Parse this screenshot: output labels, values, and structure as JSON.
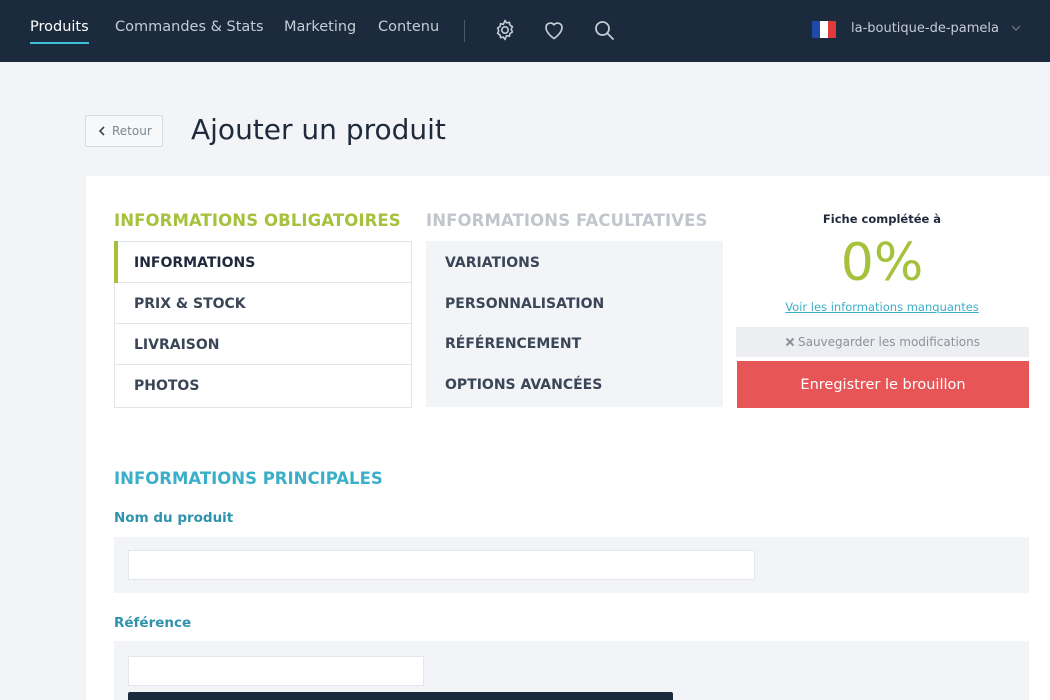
{
  "nav": {
    "items": [
      {
        "label": "Produits"
      },
      {
        "label": "Commandes & Stats"
      },
      {
        "label": "Marketing"
      },
      {
        "label": "Contenu"
      }
    ],
    "shop_name": "la-boutique-de-pamela",
    "flag_colors": [
      "#1f4aa8",
      "#ffffff",
      "#e03b3b"
    ],
    "icons": [
      "gear-icon",
      "heart-icon",
      "search-icon"
    ]
  },
  "header": {
    "back_label": "Retour",
    "title": "Ajouter un produit"
  },
  "required": {
    "title": "INFORMATIONS OBLIGATOIRES",
    "items": [
      {
        "label": "INFORMATIONS"
      },
      {
        "label": "PRIX & STOCK"
      },
      {
        "label": "LIVRAISON"
      },
      {
        "label": "PHOTOS"
      }
    ]
  },
  "optional": {
    "title": "INFORMATIONS FACULTATIVES",
    "items": [
      {
        "label": "VARIATIONS"
      },
      {
        "label": "PERSONNALISATION"
      },
      {
        "label": "RÉFÉRENCEMENT"
      },
      {
        "label": "OPTIONS AVANCÉES"
      }
    ]
  },
  "completion": {
    "label": "Fiche complétée à",
    "value": "0%",
    "link": "Voir les informations manquantes",
    "save_changes_label": "Sauvegarder les modifications",
    "draft_label": "Enregistrer le brouillon"
  },
  "form": {
    "section_title": "INFORMATIONS PRINCIPALES",
    "product_name_label": "Nom du produit",
    "product_name_value": "",
    "reference_label": "Référence",
    "reference_value": ""
  },
  "colors": {
    "navbar": "#1b2a3d",
    "accent_green": "#a6c23d",
    "accent_teal": "#3bafc9",
    "danger": "#e85557"
  }
}
